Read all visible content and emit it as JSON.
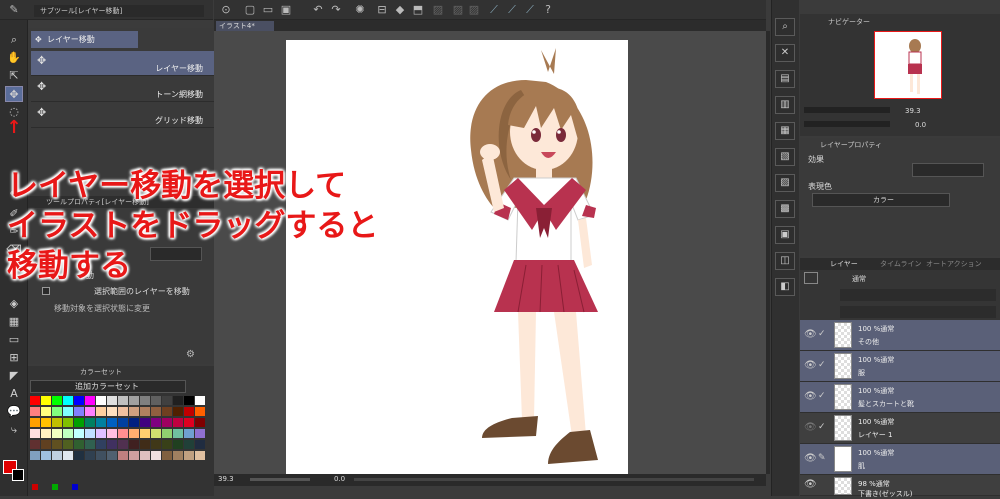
{
  "top_toolbar": {
    "sub_tool_tab": "サブツール[レイヤー移動]",
    "doc_tab": "イラスト4*",
    "navigator_tab": "ナビゲーター",
    "zoom_value": "39.3",
    "rotate_value": "0.0"
  },
  "sub_tool": {
    "group_label": "レイヤー移動",
    "items": [
      {
        "label": "レイヤー移動"
      },
      {
        "label": "トーン網移動"
      },
      {
        "label": "グリッド移動"
      }
    ]
  },
  "tool_property": {
    "title": "ツールプロパティ[レイヤー移動]",
    "rows": [
      {
        "label": "移動"
      },
      {
        "label": "選択範囲のレイヤーを移動"
      },
      {
        "label": "移動対象を選択状態に変更"
      }
    ]
  },
  "color_set": {
    "tab_label": "カラーセット",
    "set_name": "追加カラーセット",
    "swatches": [
      "#ff0000",
      "#ffff00",
      "#00ff00",
      "#00ffff",
      "#0000ff",
      "#ff00ff",
      "#ffffff",
      "#e0e0e0",
      "#c0c0c0",
      "#a0a0a0",
      "#808080",
      "#606060",
      "#404040",
      "#202020",
      "#000000",
      "#ffffff",
      "#ff8080",
      "#ffff80",
      "#80ff80",
      "#80ffff",
      "#8080ff",
      "#ff80ff",
      "#ffd0a0",
      "#ffe0c0",
      "#f0c0a0",
      "#d0a080",
      "#b08060",
      "#906040",
      "#704020",
      "#502000",
      "#c00000",
      "#ff6000",
      "#ffa000",
      "#ffc000",
      "#c0c000",
      "#80c000",
      "#00a000",
      "#008060",
      "#0080a0",
      "#0060c0",
      "#0040a0",
      "#002080",
      "#400080",
      "#800080",
      "#a00060",
      "#c00040",
      "#e00020",
      "#800000",
      "#ffe0e0",
      "#fff0c0",
      "#f0ffc0",
      "#c0ffc0",
      "#c0ffff",
      "#c0e0ff",
      "#e0c0ff",
      "#ffc0e0",
      "#ff9090",
      "#ffb070",
      "#ffd070",
      "#d0e070",
      "#90d070",
      "#70c0a0",
      "#70a0d0",
      "#9070d0",
      "#603030",
      "#604020",
      "#605020",
      "#506020",
      "#306030",
      "#306050",
      "#304060",
      "#403060",
      "#503050",
      "#402020",
      "#402c18",
      "#403818",
      "#384018",
      "#204020",
      "#204038",
      "#202c40",
      "#80a0c0",
      "#a0c0e0",
      "#c0d0e0",
      "#e0e8f0",
      "#203040",
      "#304050",
      "#405060",
      "#506070",
      "#c08080",
      "#d0a0a0",
      "#e0c0c0",
      "#f0e0e0",
      "#806040",
      "#a08060",
      "#c0a080",
      "#e0c0a0"
    ]
  },
  "annotation": {
    "line1": "レイヤー移動を選択して",
    "line2": "イラストをドラッグすると",
    "line3": "移動する"
  },
  "layer_property": {
    "title": "レイヤープロパティ",
    "effect_label": "効果",
    "color_label": "表現色",
    "color_value": "カラー"
  },
  "layers_panel": {
    "tab_layer": "レイヤー",
    "tab_2": "タイムライン",
    "tab_3": "オートアクション",
    "blend_mode": "通常",
    "layers": [
      {
        "opacity_mode": "100 %通常",
        "name": "その他",
        "selected": true
      },
      {
        "opacity_mode": "100 %通常",
        "name": "服",
        "selected": true
      },
      {
        "opacity_mode": "100 %通常",
        "name": "髪とスカートと靴",
        "selected": true
      },
      {
        "opacity_mode": "100 %通常",
        "name": "レイヤー 1",
        "selected": false
      },
      {
        "opacity_mode": "100 %通常",
        "name": "肌",
        "selected": true
      },
      {
        "opacity_mode": "98 %通常",
        "name": "下書き(ゼッスル)",
        "selected": false
      }
    ]
  },
  "colors": {
    "annotation": "#e81818",
    "selection": "#5a6078",
    "main_color": "#e00000"
  }
}
